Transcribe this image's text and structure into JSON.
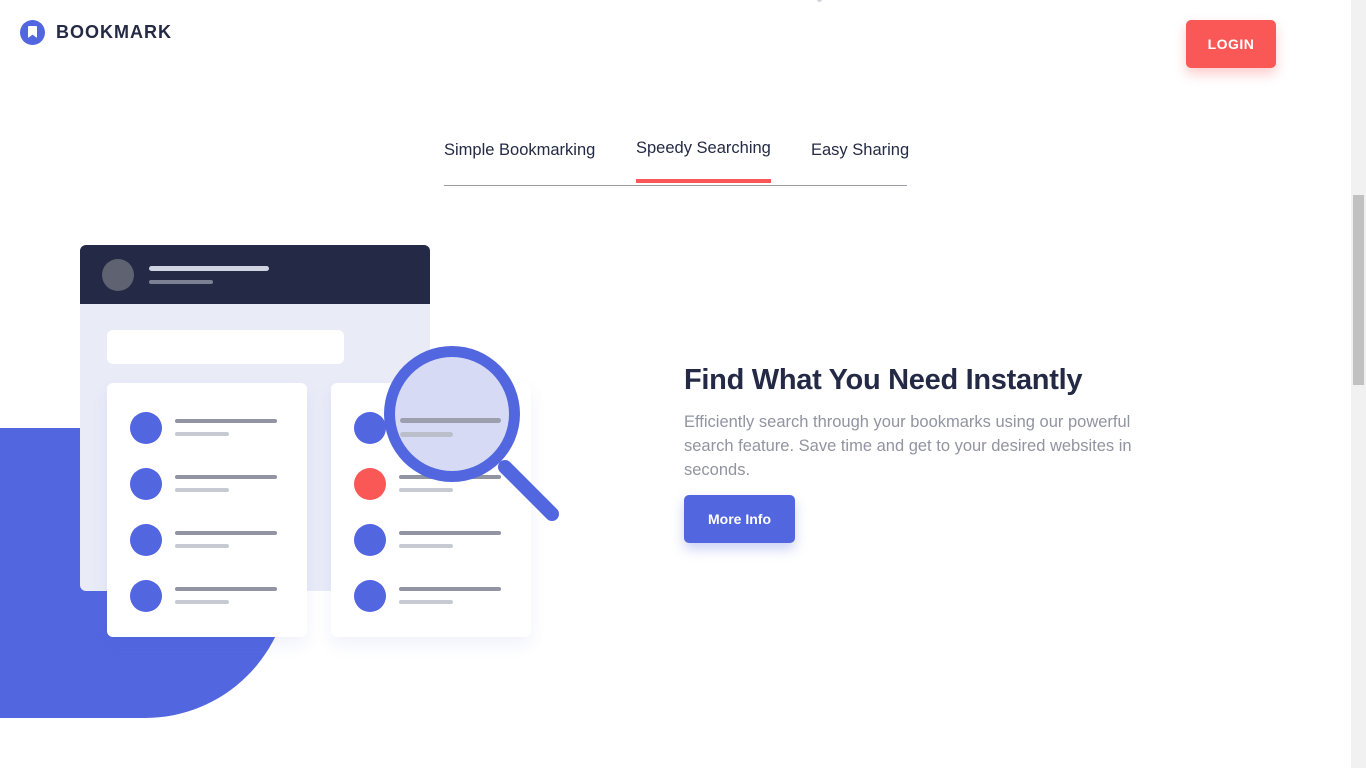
{
  "brand": {
    "name": "BOOKMARK",
    "accent_color": "#5267DF",
    "secondary_color": "#FA5757",
    "dark_color": "#242A45"
  },
  "header": {
    "login_label": "LOGIN"
  },
  "tabs": [
    {
      "label": "Simple Bookmarking",
      "active": false
    },
    {
      "label": "Speedy Searching",
      "active": true
    },
    {
      "label": "Easy Sharing",
      "active": false
    }
  ],
  "feature": {
    "title": "Find What You Need Instantly",
    "description": "Efficiently search through your bookmarks using our powerful search feature. Save time and get to your desired websites in seconds.",
    "button_label": "More Info"
  },
  "illustration": {
    "icon": "search-magnifier-illustration",
    "left_rows": 4,
    "right_rows": 4
  },
  "scrollbar": {
    "position_fraction": 0.25
  }
}
